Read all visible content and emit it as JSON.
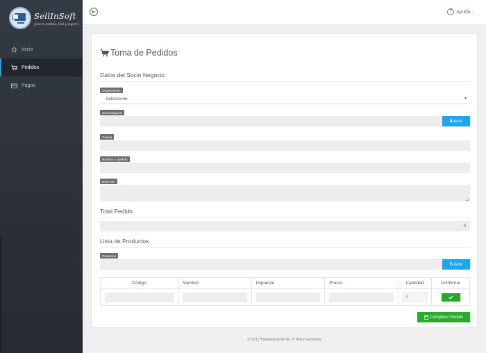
{
  "brand": {
    "name": "SellInSoft",
    "tagline": "¡Haz tu pedido, fácil y seguro!"
  },
  "sidebar": {
    "items": [
      {
        "label": "Inicio",
        "icon": "home-icon",
        "active": false
      },
      {
        "label": "Pedidos",
        "icon": "cart-icon",
        "active": true
      },
      {
        "label": "Pagos",
        "icon": "credit-card-icon",
        "active": false
      }
    ]
  },
  "topbar": {
    "back_icon": "arrow-left-circle-icon",
    "help_label": "Ayuda",
    "help_icon": "question-circle-icon"
  },
  "page": {
    "title": "Toma de Pedidos",
    "sections": {
      "socio": "Datos del Socio Negocio",
      "total": "Total Pedido",
      "productos": "Lista de Productos"
    }
  },
  "form": {
    "organizacion_label": "Organización",
    "organizacion_value": "Seleccione",
    "socio_label": "Socio Negocio",
    "buscar_label": "Buscar",
    "cedula_label": "Cedula",
    "nombre_label": "Nombre y Apellido",
    "direccion_label": "Direccion",
    "total_value": "0",
    "productos_label": "Productos"
  },
  "table": {
    "headers": [
      "Código",
      "Nombre",
      "Impuesto",
      "Precio",
      "Cantidad",
      "Confirmar"
    ],
    "cantidad_placeholder": "0"
  },
  "actions": {
    "complete_label": "Completar Pedido"
  },
  "footer": {
    "text": "© 2017 Departamento de TI Mary-lancarina"
  },
  "colors": {
    "sidebar": "#2b3038",
    "accent_blue": "#1ea5ee",
    "accent_green": "#27ad2a"
  }
}
